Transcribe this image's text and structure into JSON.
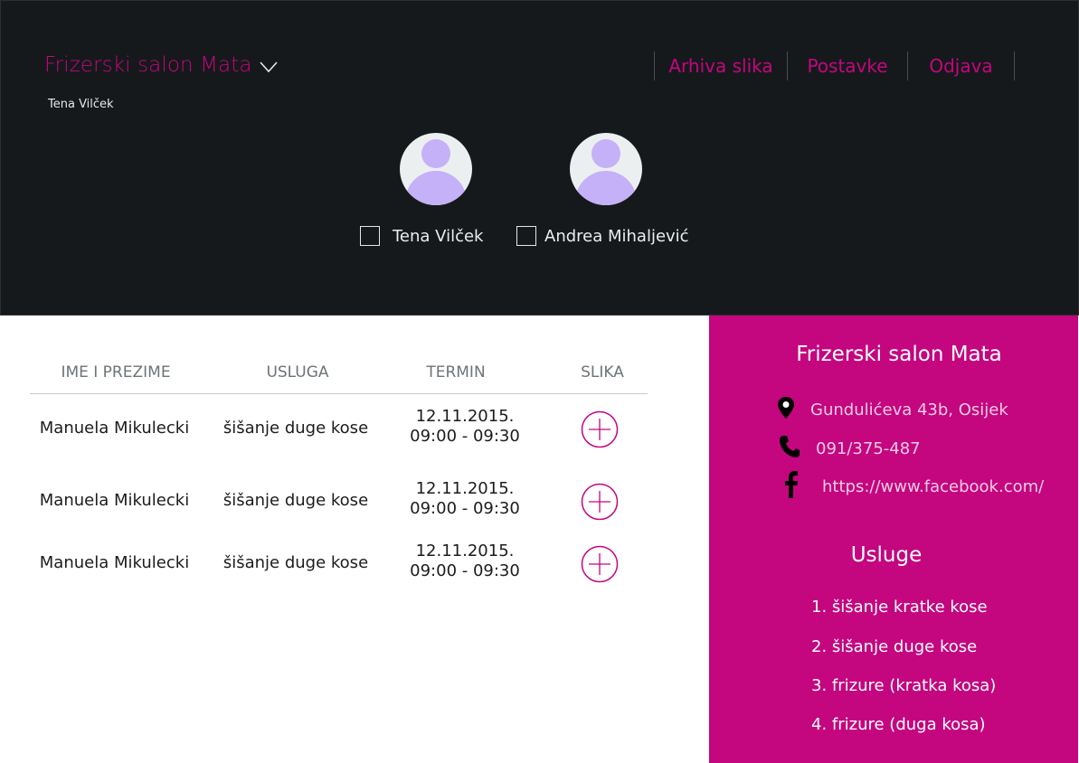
{
  "header": {
    "brand": "Frizerski salon Mata",
    "user": "Tena Vilček",
    "nav": [
      "Arhiva slika",
      "Postavke",
      "Odjava"
    ],
    "staff": [
      "Tena Vilček",
      "Andrea Mihaljević"
    ]
  },
  "table": {
    "columns": [
      "IME I PREZIME",
      "USLUGA",
      "TERMIN",
      "SLIKA"
    ],
    "rows": [
      {
        "name": "Manuela Mikulecki",
        "service": "šišanje duge kose",
        "date": "12.11.2015.",
        "time": "09:00 - 09:30"
      },
      {
        "name": "Manuela Mikulecki",
        "service": "šišanje duge kose",
        "date": "12.11.2015.",
        "time": "09:00 - 09:30"
      },
      {
        "name": "Manuela Mikulecki",
        "service": "šišanje duge kose",
        "date": "12.11.2015.",
        "time": "09:00 - 09:30"
      }
    ]
  },
  "panel": {
    "title": "Frizerski salon Mata",
    "address": "Gundulićeva 43b, Osijek",
    "phone": "091/375-487",
    "facebook": "https://www.facebook.com/",
    "services_title": "Usluge",
    "services": [
      "1. šišanje kratke kose",
      "2. šišanje duge kose",
      "3. frizure (kratka kosa)",
      "4. frizure (duga kosa)"
    ]
  },
  "colors": {
    "accent": "#c4067f",
    "header_bg": "#16191b",
    "avatar_figure": "#c5b1f7"
  },
  "icons": [
    "chevron-down-icon",
    "user-avatar-icon",
    "checkbox-icon",
    "add-circle-icon",
    "map-pin-icon",
    "phone-icon",
    "facebook-icon"
  ]
}
